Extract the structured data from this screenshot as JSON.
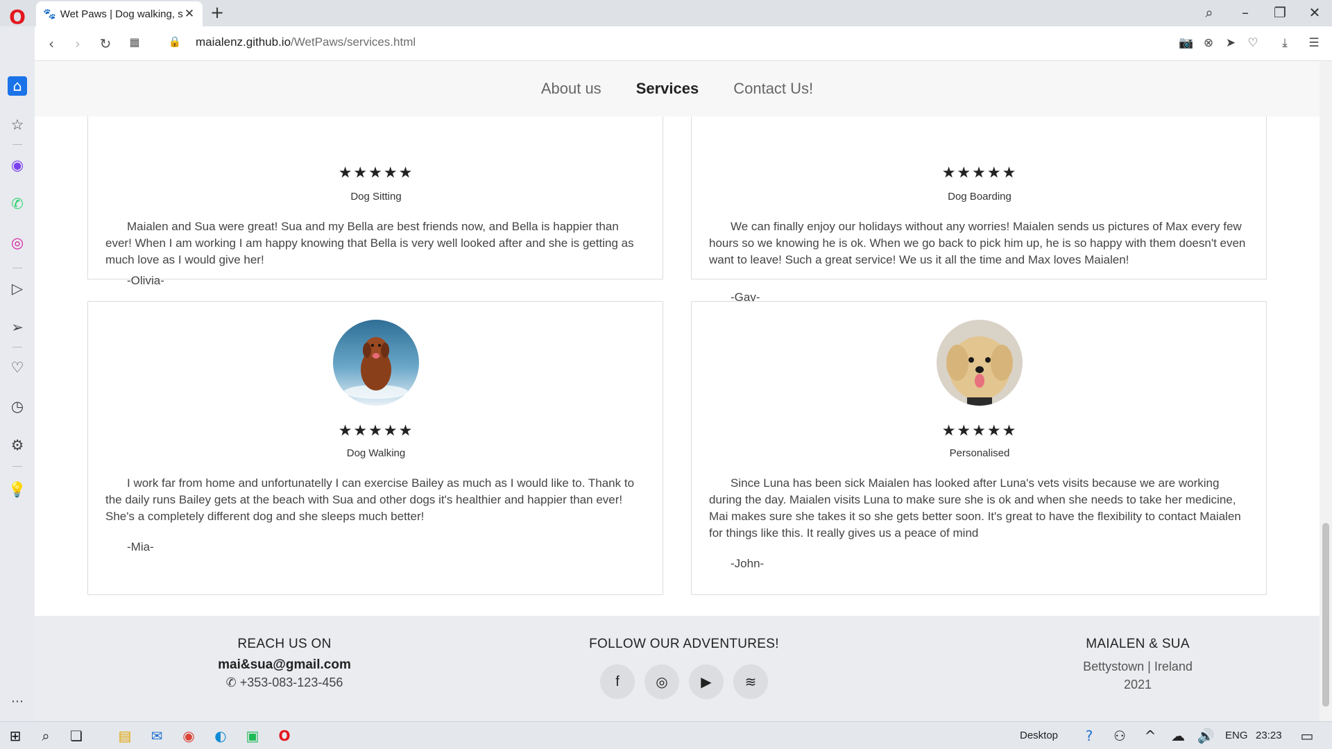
{
  "browser": {
    "tab_title": "Wet Paws | Dog walking, si",
    "url_host": "maialenz.github.io",
    "url_path": "/WetPaws/services.html"
  },
  "nav": {
    "items": [
      {
        "label": "About us"
      },
      {
        "label": "Services"
      },
      {
        "label": "Contact Us!"
      }
    ]
  },
  "reviews": [
    {
      "service": "Dog Sitting",
      "rating": 5,
      "text": "Maialen and Sua were great! Sua and my Bella are best friends now, and Bella is happier than ever! When I am working I am happy knowing that Bella is very well looked after and she is getting as much love as I would give her!",
      "author": "-Olivia-"
    },
    {
      "service": "Dog Boarding",
      "rating": 5,
      "text": "We can finally enjoy our holidays without any worries! Maialen sends us pictures of Max every few hours so we knowing he is ok. When we go back to pick him up, he is so happy with them doesn't even want to leave! Such a great service! We us it all the time and Max loves Maialen!",
      "author": "-Gav-"
    },
    {
      "service": "Dog Walking",
      "rating": 5,
      "text": "I work far from home and unfortunatelly I can exercise Bailey as much as I would like to. Thank to the daily runs Bailey gets at the beach with Sua and other dogs it's healthier and happier than ever! She's a completely different dog and she sleeps much better!",
      "author": "-Mia-"
    },
    {
      "service": "Personalised",
      "rating": 5,
      "text": "Since Luna has been sick Maialen has looked after Luna's vets visits because we are working during the day. Maialen visits Luna to make sure she is ok and when she needs to take her medicine, Mai makes sure she takes it so she gets better soon. It's great to have the flexibility to contact Maialen for things like this. It really gives us a peace of mind",
      "author": "-John-"
    }
  ],
  "footer": {
    "reach_heading": "REACH US ON",
    "email": "mai&sua@gmail.com",
    "phone": "+353-083-123-456",
    "follow_heading": "FOLLOW OUR ADVENTURES!",
    "brand_heading": "MAIALEN & SUA",
    "location": "Bettystown | Ireland",
    "year": "2021"
  },
  "taskbar": {
    "desktop_label": "Desktop",
    "language": "ENG",
    "time": "23:23"
  }
}
